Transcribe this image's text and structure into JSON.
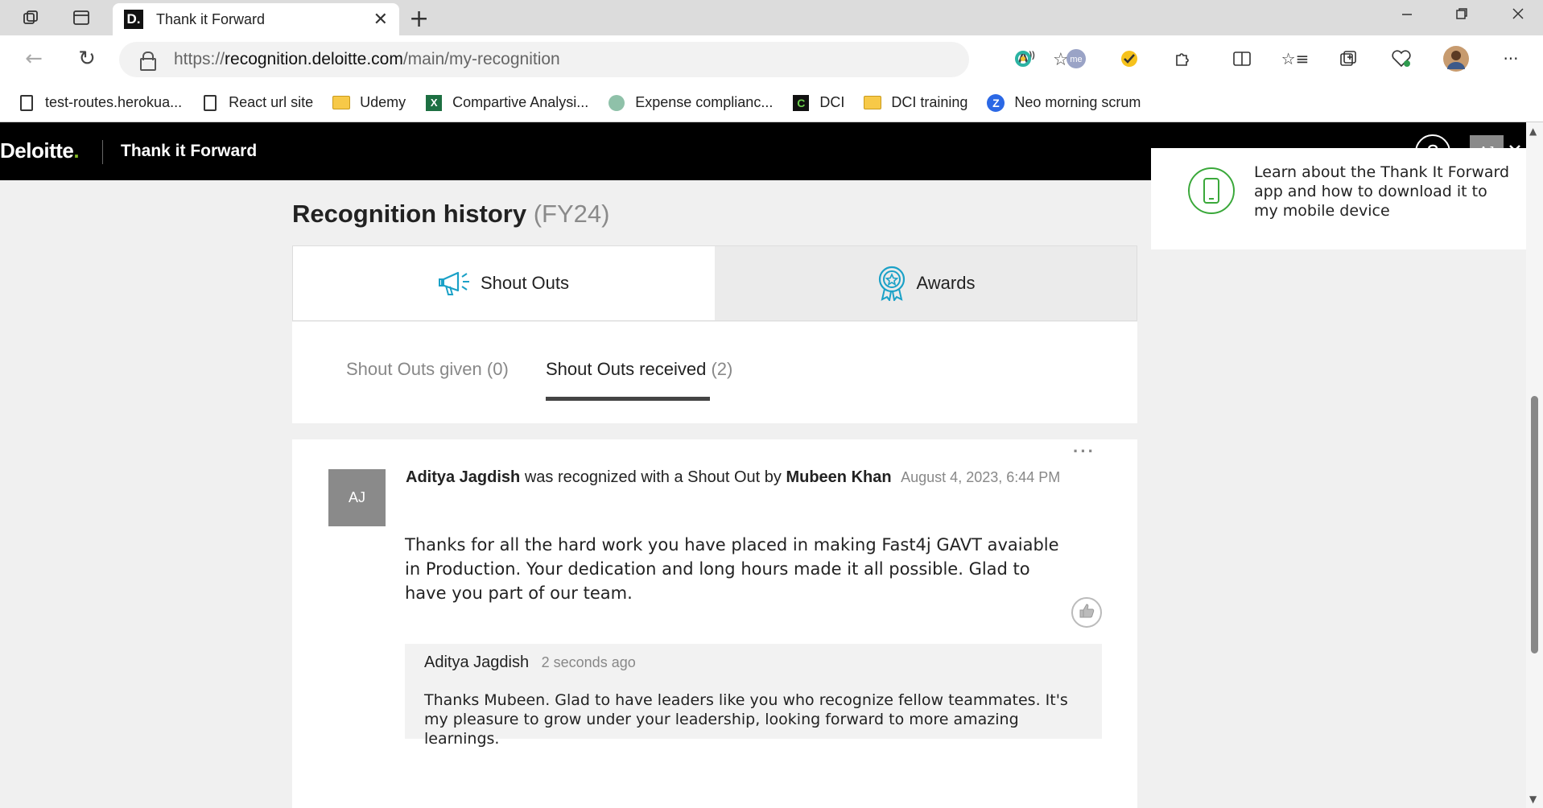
{
  "browser": {
    "tab_title": "Thank it Forward",
    "favicon_letter": "D.",
    "new_tab_symbol": "+",
    "close_symbol": "✕",
    "url_prefix": "https://",
    "url_host": "recognition.deloitte.com",
    "url_path": "/main/my-recognition",
    "bookmarks": [
      {
        "label": "test-routes.herokua...",
        "icon": "page-icon"
      },
      {
        "label": "React url site",
        "icon": "page-icon"
      },
      {
        "label": "Udemy",
        "icon": "folder-icon"
      },
      {
        "label": "Compartive Analysi...",
        "icon": "excel-icon"
      },
      {
        "label": "Expense complianc...",
        "icon": "app-circle-icon"
      },
      {
        "label": "DCI",
        "icon": "dci-icon"
      },
      {
        "label": "DCI training",
        "icon": "folder-icon"
      },
      {
        "label": "Neo morning scrum",
        "icon": "zoom-icon"
      }
    ],
    "excel_letter": "X",
    "dci_letter": "C",
    "zoom_letter": "Z"
  },
  "app": {
    "brand": "Deloitte",
    "brand_dot": ".",
    "brand_accent_color": "#86bc25",
    "name": "Thank it Forward",
    "help_symbol": "?",
    "user_initials": "AJ"
  },
  "page": {
    "title": "Recognition history",
    "fiscal_year": "(FY24)"
  },
  "tabs": {
    "shout_outs": "Shout Outs",
    "awards": "Awards"
  },
  "subtabs": {
    "given_label": "Shout Outs given",
    "given_count": "(0)",
    "received_label": "Shout Outs received",
    "received_count": "(2)"
  },
  "recognition": {
    "avatar_initials": "AJ",
    "recipient": "Aditya Jagdish",
    "connector": "was recognized with a Shout Out by",
    "giver": "Mubeen Khan",
    "date": "August 4, 2023, 6:44 PM",
    "message": "Thanks for all the hard work you have placed in making Fast4j GAVT avaiable in Production. Your dedication and long hours made it all possible. Glad to have you part of our team.",
    "more_symbol": "···",
    "reply": {
      "author": "Aditya Jagdish",
      "time": "2 seconds ago",
      "text": "Thanks Mubeen. Glad to have leaders like you who recognize fellow teammates. It's my pleasure to grow under your leadership, looking forward to more amazing learnings."
    }
  },
  "promo": {
    "text": "Learn about the Thank It Forward app and how to download it to my mobile device"
  }
}
